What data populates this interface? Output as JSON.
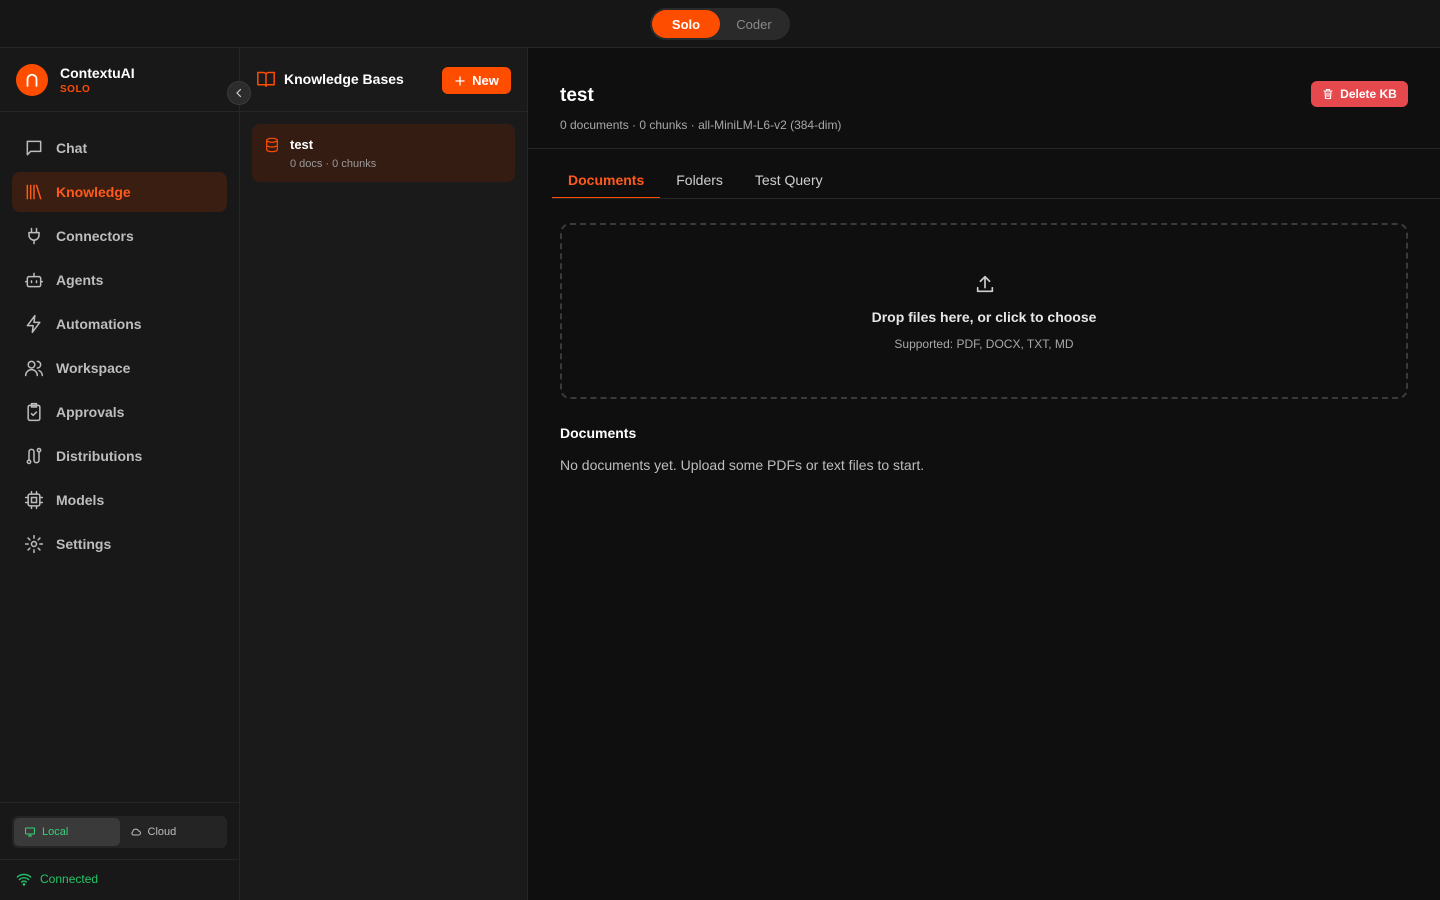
{
  "topbar": {
    "modes": [
      {
        "label": "Solo",
        "active": true
      },
      {
        "label": "Coder",
        "active": false
      }
    ]
  },
  "brand": {
    "name": "ContextuAI",
    "edition": "SOLO",
    "accent": "#ff4d00"
  },
  "sidebar": {
    "items": [
      {
        "label": "Chat",
        "icon": "chat-icon",
        "active": false
      },
      {
        "label": "Knowledge",
        "icon": "library-icon",
        "active": true
      },
      {
        "label": "Connectors",
        "icon": "plug-icon",
        "active": false
      },
      {
        "label": "Agents",
        "icon": "bot-icon",
        "active": false
      },
      {
        "label": "Automations",
        "icon": "zap-icon",
        "active": false
      },
      {
        "label": "Workspace",
        "icon": "users-icon",
        "active": false
      },
      {
        "label": "Approvals",
        "icon": "clipboard-check-icon",
        "active": false
      },
      {
        "label": "Distributions",
        "icon": "route-icon",
        "active": false
      },
      {
        "label": "Models",
        "icon": "cpu-icon",
        "active": false
      },
      {
        "label": "Settings",
        "icon": "gear-icon",
        "active": false
      }
    ],
    "location": {
      "options": [
        {
          "label": "Local",
          "icon": "monitor-icon",
          "active": true
        },
        {
          "label": "Cloud",
          "icon": "cloud-icon",
          "active": false
        }
      ]
    },
    "status": {
      "label": "Connected",
      "color": "#27c46a"
    }
  },
  "kb_panel": {
    "title": "Knowledge Bases",
    "new_label": "New",
    "items": [
      {
        "name": "test",
        "meta": "0 docs · 0 chunks",
        "active": true
      }
    ]
  },
  "main": {
    "title": "test",
    "meta": "0 documents · 0 chunks · all-MiniLM-L6-v2 (384-dim)",
    "delete_label": "Delete KB",
    "delete_color": "#e5484d",
    "tabs": [
      {
        "label": "Documents",
        "active": true
      },
      {
        "label": "Folders",
        "active": false
      },
      {
        "label": "Test Query",
        "active": false
      }
    ],
    "dropzone": {
      "title": "Drop files here, or click to choose",
      "supported": "Supported: PDF, DOCX, TXT, MD"
    },
    "documents": {
      "heading": "Documents",
      "empty": "No documents yet. Upload some PDFs or text files to start."
    }
  }
}
